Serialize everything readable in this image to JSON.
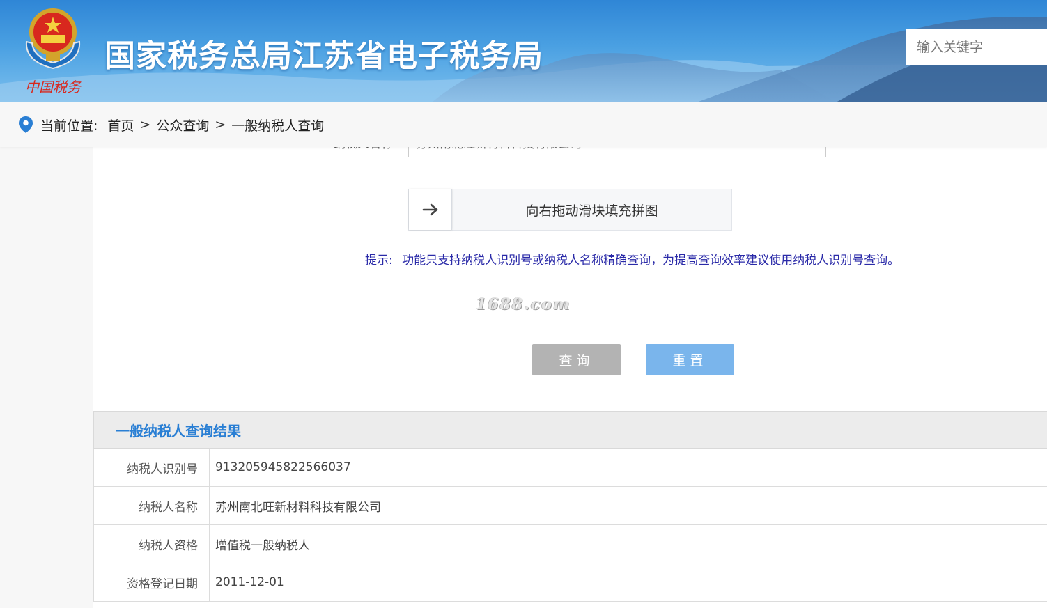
{
  "header": {
    "site_title": "国家税务总局江苏省电子税务局",
    "search_placeholder": "输入关键字",
    "logo_caption": "中国税务"
  },
  "breadcrumb": {
    "label": "当前位置:",
    "items": [
      "首页",
      "公众查询",
      "一般纳税人查询"
    ],
    "separator": ">"
  },
  "form": {
    "prev_field_label": "纳税人名称",
    "prev_field_value": "苏州南北旺新材料科技有限公司",
    "slider_text": "向右拖动滑块填充拼图",
    "hint_label": "提示:",
    "hint_text": "功能只支持纳税人识别号或纳税人名称精确查询，为提高查询效率建议使用纳税人识别号查询。",
    "watermark": "1688.com",
    "query_button": "查询",
    "reset_button": "重置"
  },
  "results": {
    "title": "一般纳税人查询结果",
    "rows": [
      {
        "label": "纳税人识别号",
        "value": "913205945822566037"
      },
      {
        "label": "纳税人名称",
        "value": "苏州南北旺新材料科技有限公司"
      },
      {
        "label": "纳税人资格",
        "value": "增值税一般纳税人"
      },
      {
        "label": "资格登记日期",
        "value": "2011-12-01"
      }
    ]
  },
  "colors": {
    "header_blue": "#2f86d6",
    "result_title": "#2a7fd4",
    "hint_text": "#2a2aa8",
    "query_button": "#b3b3b3",
    "reset_button": "#7ab5ec"
  }
}
